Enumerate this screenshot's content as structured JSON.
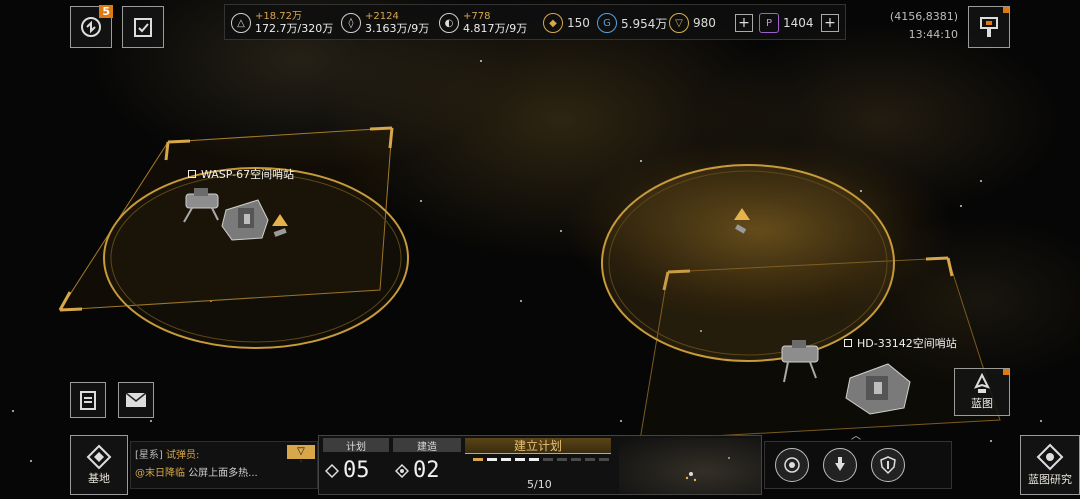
{
  "top_left": {
    "alerts_badge": "5"
  },
  "resources": [
    {
      "icon": "triangle-icon",
      "gain": "+18.72万",
      "amount": "172.7万/320万"
    },
    {
      "icon": "crystal-icon",
      "gain": "+2124",
      "amount": "3.163万/9万"
    },
    {
      "icon": "gas-icon",
      "gain": "+778",
      "amount": "4.817万/9万"
    }
  ],
  "currencies": [
    {
      "icon": "diamond-icon",
      "value": "150"
    },
    {
      "icon": "cycle-icon",
      "value": "5.954万"
    },
    {
      "icon": "badge-icon",
      "value": "980"
    },
    {
      "icon": "hexagon-icon",
      "value": "1404"
    }
  ],
  "coords": "(4156,8381)",
  "clock": "13:44:10",
  "stations": [
    {
      "label": "WASP-67空间哨站"
    },
    {
      "label": "HD-33142空间哨站"
    }
  ],
  "blueprint_btn": "蓝图",
  "base_btn": "基地",
  "chat": {
    "channel": "[星系]",
    "sender": "试弹员:",
    "line2_name": "@末日降临",
    "line2_text": "公屏上面多热..."
  },
  "plan": {
    "tab_plan": "计划",
    "tab_build": "建造",
    "plan_count": "05",
    "build_count": "02",
    "build_plan_title": "建立计划",
    "progress": "5/10",
    "progress_value": 5,
    "progress_max": 10
  },
  "research_btn": "蓝图研究",
  "colors": {
    "accent": "#d7a74a",
    "alert": "#e07a10"
  }
}
